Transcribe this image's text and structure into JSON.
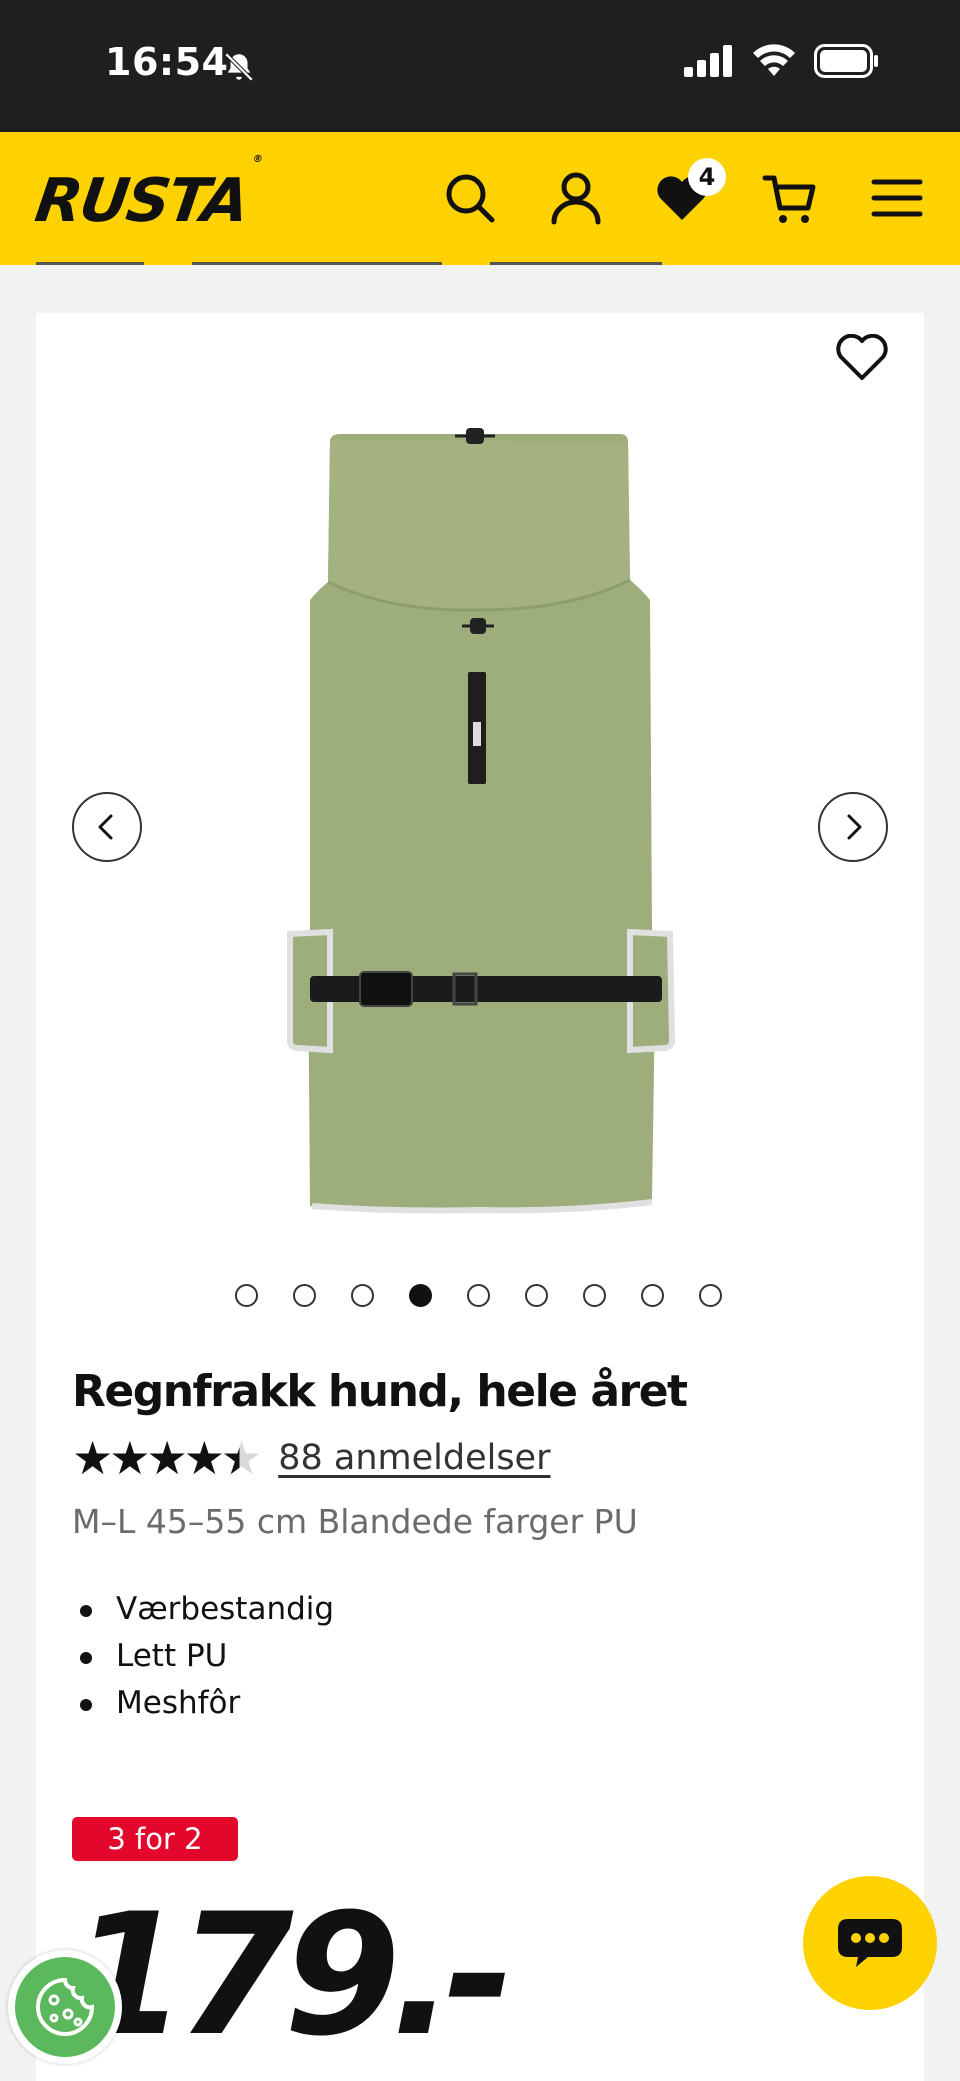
{
  "status_bar": {
    "time": "16:54",
    "icons": [
      "bell-slash-icon",
      "cellular-signal-icon",
      "wifi-icon",
      "battery-icon"
    ]
  },
  "header": {
    "logo_text": "RUSTA",
    "logo_mark": "®",
    "icons": [
      "search-icon",
      "account-icon",
      "wishlist-heart-icon",
      "cart-icon",
      "menu-icon"
    ],
    "wishlist_count": "4",
    "brand_color": "#fed200"
  },
  "product": {
    "image_icon": "dog-raincoat-product-image",
    "carousel": {
      "total_slides": 9,
      "active_slide": 4
    },
    "title": "Regnfrakk hund, hele året",
    "rating": {
      "stars": "★★★★★",
      "value": 4.5,
      "reviews_label": "88 anmeldelser"
    },
    "subtitle": "M–L 45–55 cm Blandede farger PU",
    "features": [
      "Værbestandig",
      "Lett PU",
      "Meshfôr"
    ],
    "promo_label": "3 for 2",
    "promo_color": "#e3072c",
    "price": "179.-"
  },
  "floating": {
    "chat_icon": "chat-bubble-icon",
    "cookie_icon": "cookie-settings-icon"
  }
}
